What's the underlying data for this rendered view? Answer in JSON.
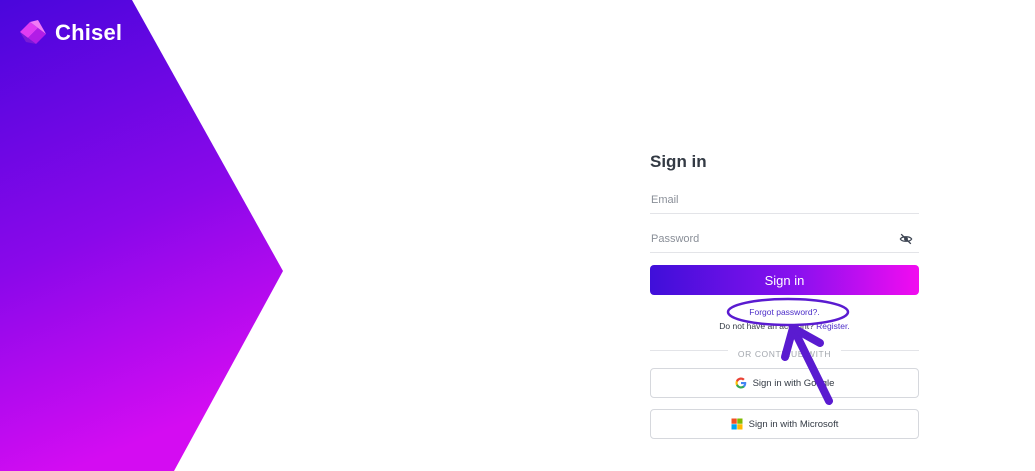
{
  "brand": {
    "name": "Chisel",
    "gradient_top": "#4a06dc",
    "gradient_bottom": "#d40cf2"
  },
  "form": {
    "title": "Sign in",
    "email_placeholder": "Email",
    "password_placeholder": "Password",
    "signin_label": "Sign in",
    "forgot_label": "Forgot password?.",
    "no_account_text": "Do not have an account?",
    "register_label": "Register.",
    "divider_label": "OR CONTINUE WITH",
    "google_label": "Sign in with Google",
    "microsoft_label": "Sign in with Microsoft"
  },
  "icons": {
    "password_toggle": "eye-slash-icon",
    "google": "google-icon",
    "microsoft": "microsoft-icon"
  },
  "colors": {
    "button_gradient_start": "#3f0fd9",
    "button_gradient_end": "#f20cf0",
    "link": "#4b2cc8",
    "annotation": "#5a1bd0"
  }
}
